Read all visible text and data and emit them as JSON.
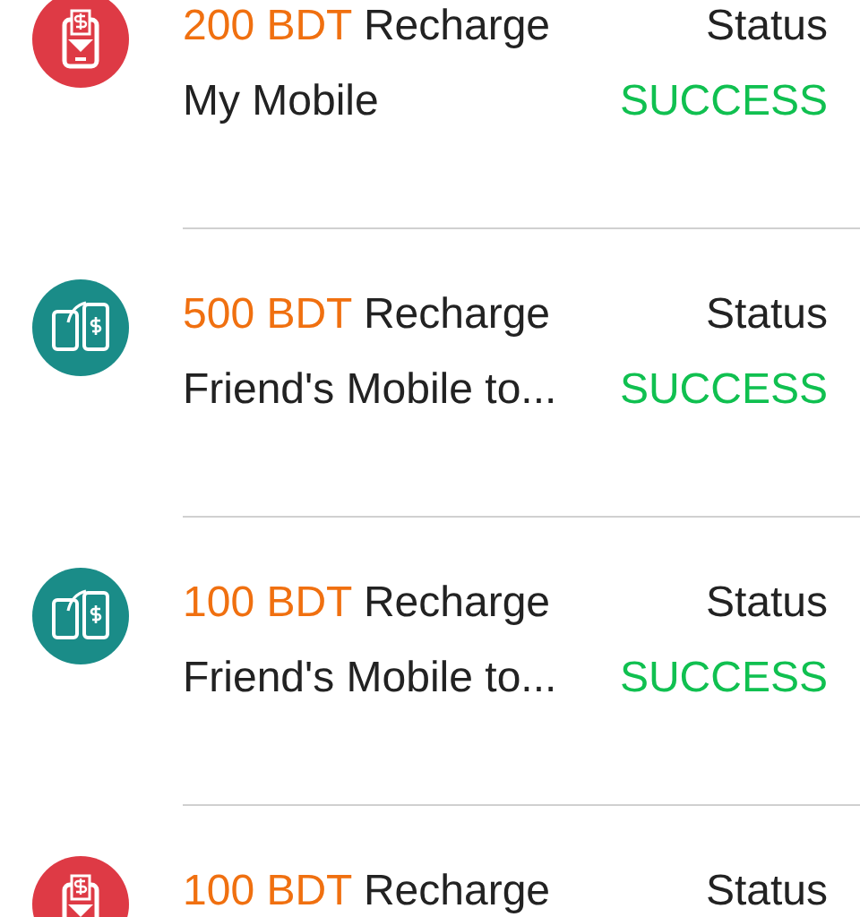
{
  "transactions": [
    {
      "kind": "self",
      "amount": "200 BDT",
      "title": "Recharge",
      "subtitle": "My Mobile",
      "status_label": "Status",
      "status": "SUCCESS"
    },
    {
      "kind": "friend",
      "amount": "500 BDT",
      "title": "Recharge",
      "subtitle": "Friend's Mobile to...",
      "status_label": "Status",
      "status": "SUCCESS"
    },
    {
      "kind": "friend",
      "amount": "100 BDT",
      "title": "Recharge",
      "subtitle": "Friend's Mobile to...",
      "status_label": "Status",
      "status": "SUCCESS"
    },
    {
      "kind": "self",
      "amount": "100 BDT",
      "title": "Recharge",
      "status_label": "Status"
    }
  ]
}
